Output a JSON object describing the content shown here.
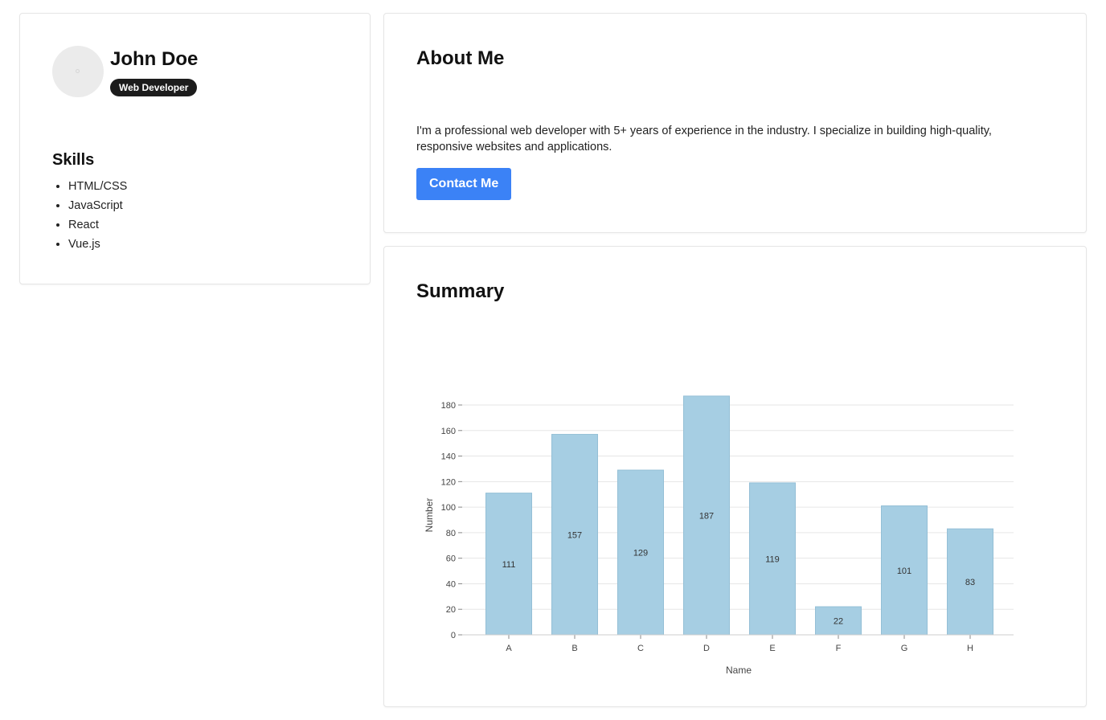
{
  "profile": {
    "name": "John Doe",
    "role": "Web Developer",
    "avatar_icon": "avatar-placeholder-icon",
    "skills_heading": "Skills",
    "skills": [
      "HTML/CSS",
      "JavaScript",
      "React",
      "Vue.js"
    ]
  },
  "about": {
    "heading": "About Me",
    "text": "I'm a professional web developer with 5+ years of experience in the industry. I specialize in building high-quality, responsive websites and applications.",
    "contact_label": "Contact Me"
  },
  "summary": {
    "heading": "Summary"
  },
  "colors": {
    "accent": "#3b82f6",
    "badge_bg": "#1c1c1c",
    "bar_fill": "#a6cee3"
  },
  "chart_data": {
    "type": "bar",
    "categories": [
      "A",
      "B",
      "C",
      "D",
      "E",
      "F",
      "G",
      "H"
    ],
    "values": [
      111,
      157,
      129,
      187,
      119,
      22,
      101,
      83
    ],
    "xlabel": "Name",
    "ylabel": "Number",
    "ylim": [
      0,
      180
    ],
    "yticks": [
      0,
      20,
      40,
      60,
      80,
      100,
      120,
      140,
      160,
      180
    ],
    "grid": true,
    "data_labels": true
  }
}
